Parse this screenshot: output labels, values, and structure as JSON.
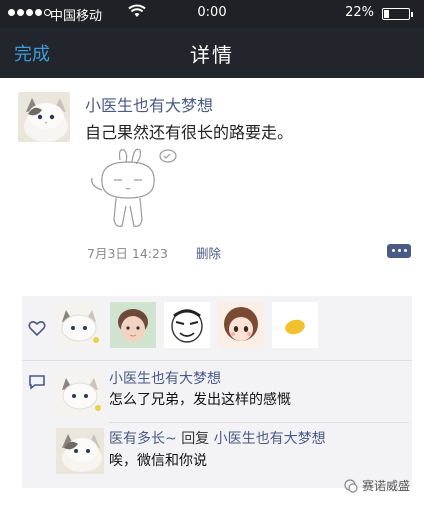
{
  "status_bar": {
    "carrier": "中国移动",
    "time": "0:00",
    "battery": "22%",
    "battery_level": 0.22,
    "signal_bars": 4
  },
  "nav": {
    "back_label": "完成",
    "title": "详情",
    "accent_color": "#3e9bd9"
  },
  "post": {
    "author": "小医生也有大梦想",
    "text": "自己果然还有很长的路要走。",
    "time": "7月3日 14:23",
    "delete_label": "删除"
  },
  "likes": {
    "users": [
      "cat-avatar",
      "child-avatar",
      "meme-face-avatar",
      "anime-girl-avatar",
      "yellow-bean-avatar"
    ]
  },
  "comments": [
    {
      "author": "小医生也有大梦想",
      "text": "怎么了兄弟，发出这样的感慨"
    },
    {
      "author": "医有多长~",
      "reply_word": "回复",
      "reply_to": "小医生也有大梦想",
      "text": "唉，微信和你说"
    }
  ],
  "watermark": {
    "text": "赛诺威盛"
  },
  "colors": {
    "link_blue": "#4a5a86",
    "nav_background": "#22252b",
    "panel_background": "#f3f3f5"
  }
}
